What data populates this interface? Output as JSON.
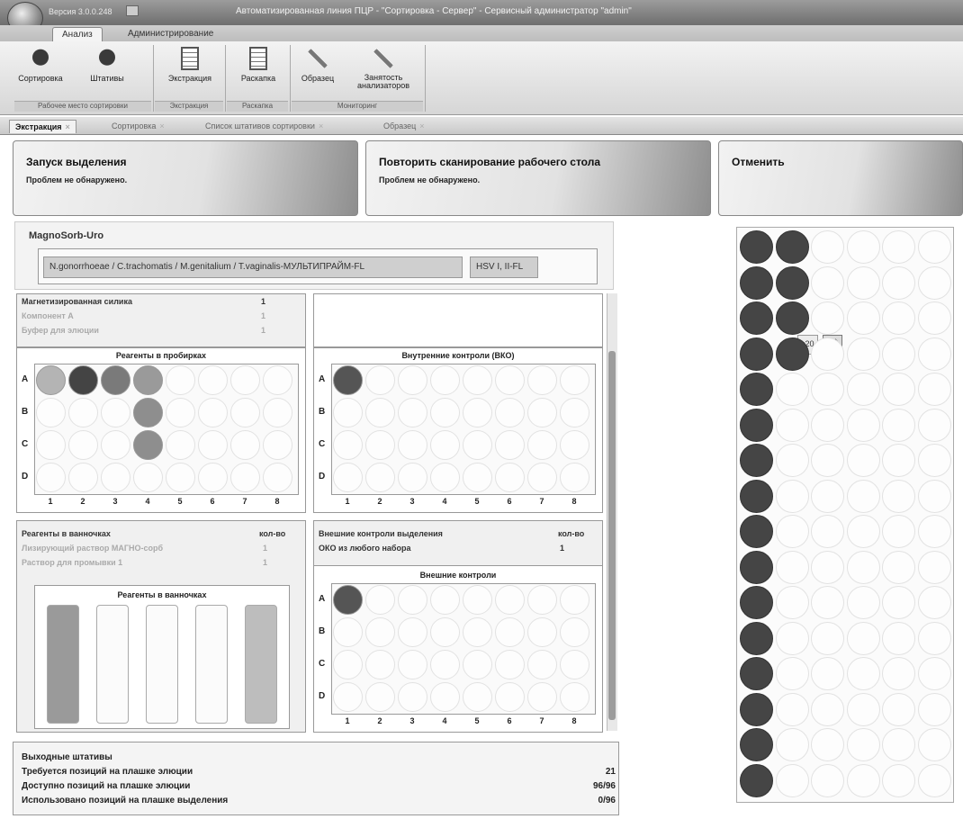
{
  "window": {
    "version": "Версия 3.0.0.248",
    "title": "Автоматизированная линия ПЦР - \"Сортировка - Сервер\" - Сервисный администратор \"admin\""
  },
  "ribbon": {
    "tabs": [
      "Анализ",
      "Администрирование"
    ],
    "buttons": [
      {
        "label": "Сортировка",
        "icon": "elephant-icon"
      },
      {
        "label": "Штативы",
        "icon": "elephant-icon"
      },
      {
        "label": "Экстракция",
        "icon": "document-icon"
      },
      {
        "label": "Раскапка",
        "icon": "document-icon"
      },
      {
        "label": "Образец",
        "icon": "wrench-icon"
      },
      {
        "label": "Занятость анализаторов",
        "icon": "wrench-icon"
      }
    ],
    "groups": [
      "Рабочее место сортировки",
      "Экстракция",
      "Раскапка",
      "Мониторинг"
    ]
  },
  "doc_tabs": [
    "Экстракция",
    "Сортировка",
    "Список штативов сортировки",
    "Образец"
  ],
  "commands": [
    {
      "title": "Запуск выделения",
      "status": "Проблем не обнаружено."
    },
    {
      "title": "Повторить сканирование рабочего стола",
      "status": "Проблем не обнаружено."
    },
    {
      "title": "Отменить",
      "status": ""
    }
  ],
  "kit": {
    "name": "MagnoSorb-Uro",
    "tests": [
      "N.gonorrhoeae / C.trachomatis / M.genitalium / T.vaginalis-МУЛЬТИПРАЙМ-FL",
      "HSV I, II-FL"
    ]
  },
  "reagents_tubes": {
    "items": [
      {
        "name": "Магнетизированная силика",
        "qty": "1",
        "faded": false
      },
      {
        "name": "Компонент А",
        "qty": "1",
        "faded": true
      },
      {
        "name": "Буфер для элюции",
        "qty": "1",
        "faded": true
      }
    ],
    "title": "Реагенты в пробирках",
    "rows": [
      "A",
      "B",
      "C",
      "D"
    ],
    "cols": [
      "1",
      "2",
      "3",
      "4",
      "5",
      "6",
      "7",
      "8"
    ],
    "filled": [
      {
        "row": 0,
        "col": 0,
        "color": "#b4b4b4"
      },
      {
        "row": 0,
        "col": 1,
        "color": "#444444"
      },
      {
        "row": 0,
        "col": 2,
        "color": "#7a7a7a"
      },
      {
        "row": 0,
        "col": 3,
        "color": "#9a9a9a"
      },
      {
        "row": 1,
        "col": 3,
        "color": "#8e8e8e"
      },
      {
        "row": 2,
        "col": 3,
        "color": "#8e8e8e"
      }
    ]
  },
  "internal_controls": {
    "title": "Внутренние контроли (ВКО)",
    "rows": [
      "A",
      "B",
      "C",
      "D"
    ],
    "cols": [
      "1",
      "2",
      "3",
      "4",
      "5",
      "6",
      "7",
      "8"
    ],
    "filled": [
      {
        "row": 0,
        "col": 0,
        "color": "#555555"
      }
    ]
  },
  "reagents_troughs": {
    "header": "Реагенты в ванночках",
    "qty_header": "кол-во",
    "items": [
      {
        "name": "Лизирующий раствор МАГНО-сорб",
        "qty": "1"
      },
      {
        "name": "Раствор для промывки 1",
        "qty": "1"
      }
    ],
    "title": "Реагенты в ванночках",
    "troughs": [
      {
        "color": "#9a9a9a"
      },
      {
        "color": "#fbfbfb"
      },
      {
        "color": "#fbfbfb"
      },
      {
        "color": "#fbfbfb"
      },
      {
        "color": "#bdbdbd"
      }
    ]
  },
  "external_controls": {
    "header": "Внешние контроли выделения",
    "qty_header": "кол-во",
    "items": [
      {
        "name": "ОКО из любого набора",
        "qty": "1"
      }
    ],
    "title": "Внешние контроли",
    "rows": [
      "A",
      "B",
      "C",
      "D"
    ],
    "cols": [
      "1",
      "2",
      "3",
      "4",
      "5",
      "6",
      "7",
      "8"
    ],
    "filled": [
      {
        "row": 0,
        "col": 0,
        "color": "#555555"
      }
    ]
  },
  "outputs": {
    "title": "Выходные штативы",
    "rows": [
      {
        "label": "Требуется позиций на плашке элюции",
        "value": "21"
      },
      {
        "label": "Доступно позиций на плашке элюции",
        "value": "96/96"
      },
      {
        "label": "Использовано позиций на плашке выделения",
        "value": "0/96"
      }
    ]
  },
  "rack": {
    "rows": 16,
    "cols": 6,
    "filled_counts": [
      2,
      2,
      2,
      2,
      1,
      1,
      1,
      1,
      1,
      1,
      1,
      1,
      1,
      1,
      1,
      1
    ],
    "fill_color": "#454545",
    "tooltip": "s20"
  }
}
